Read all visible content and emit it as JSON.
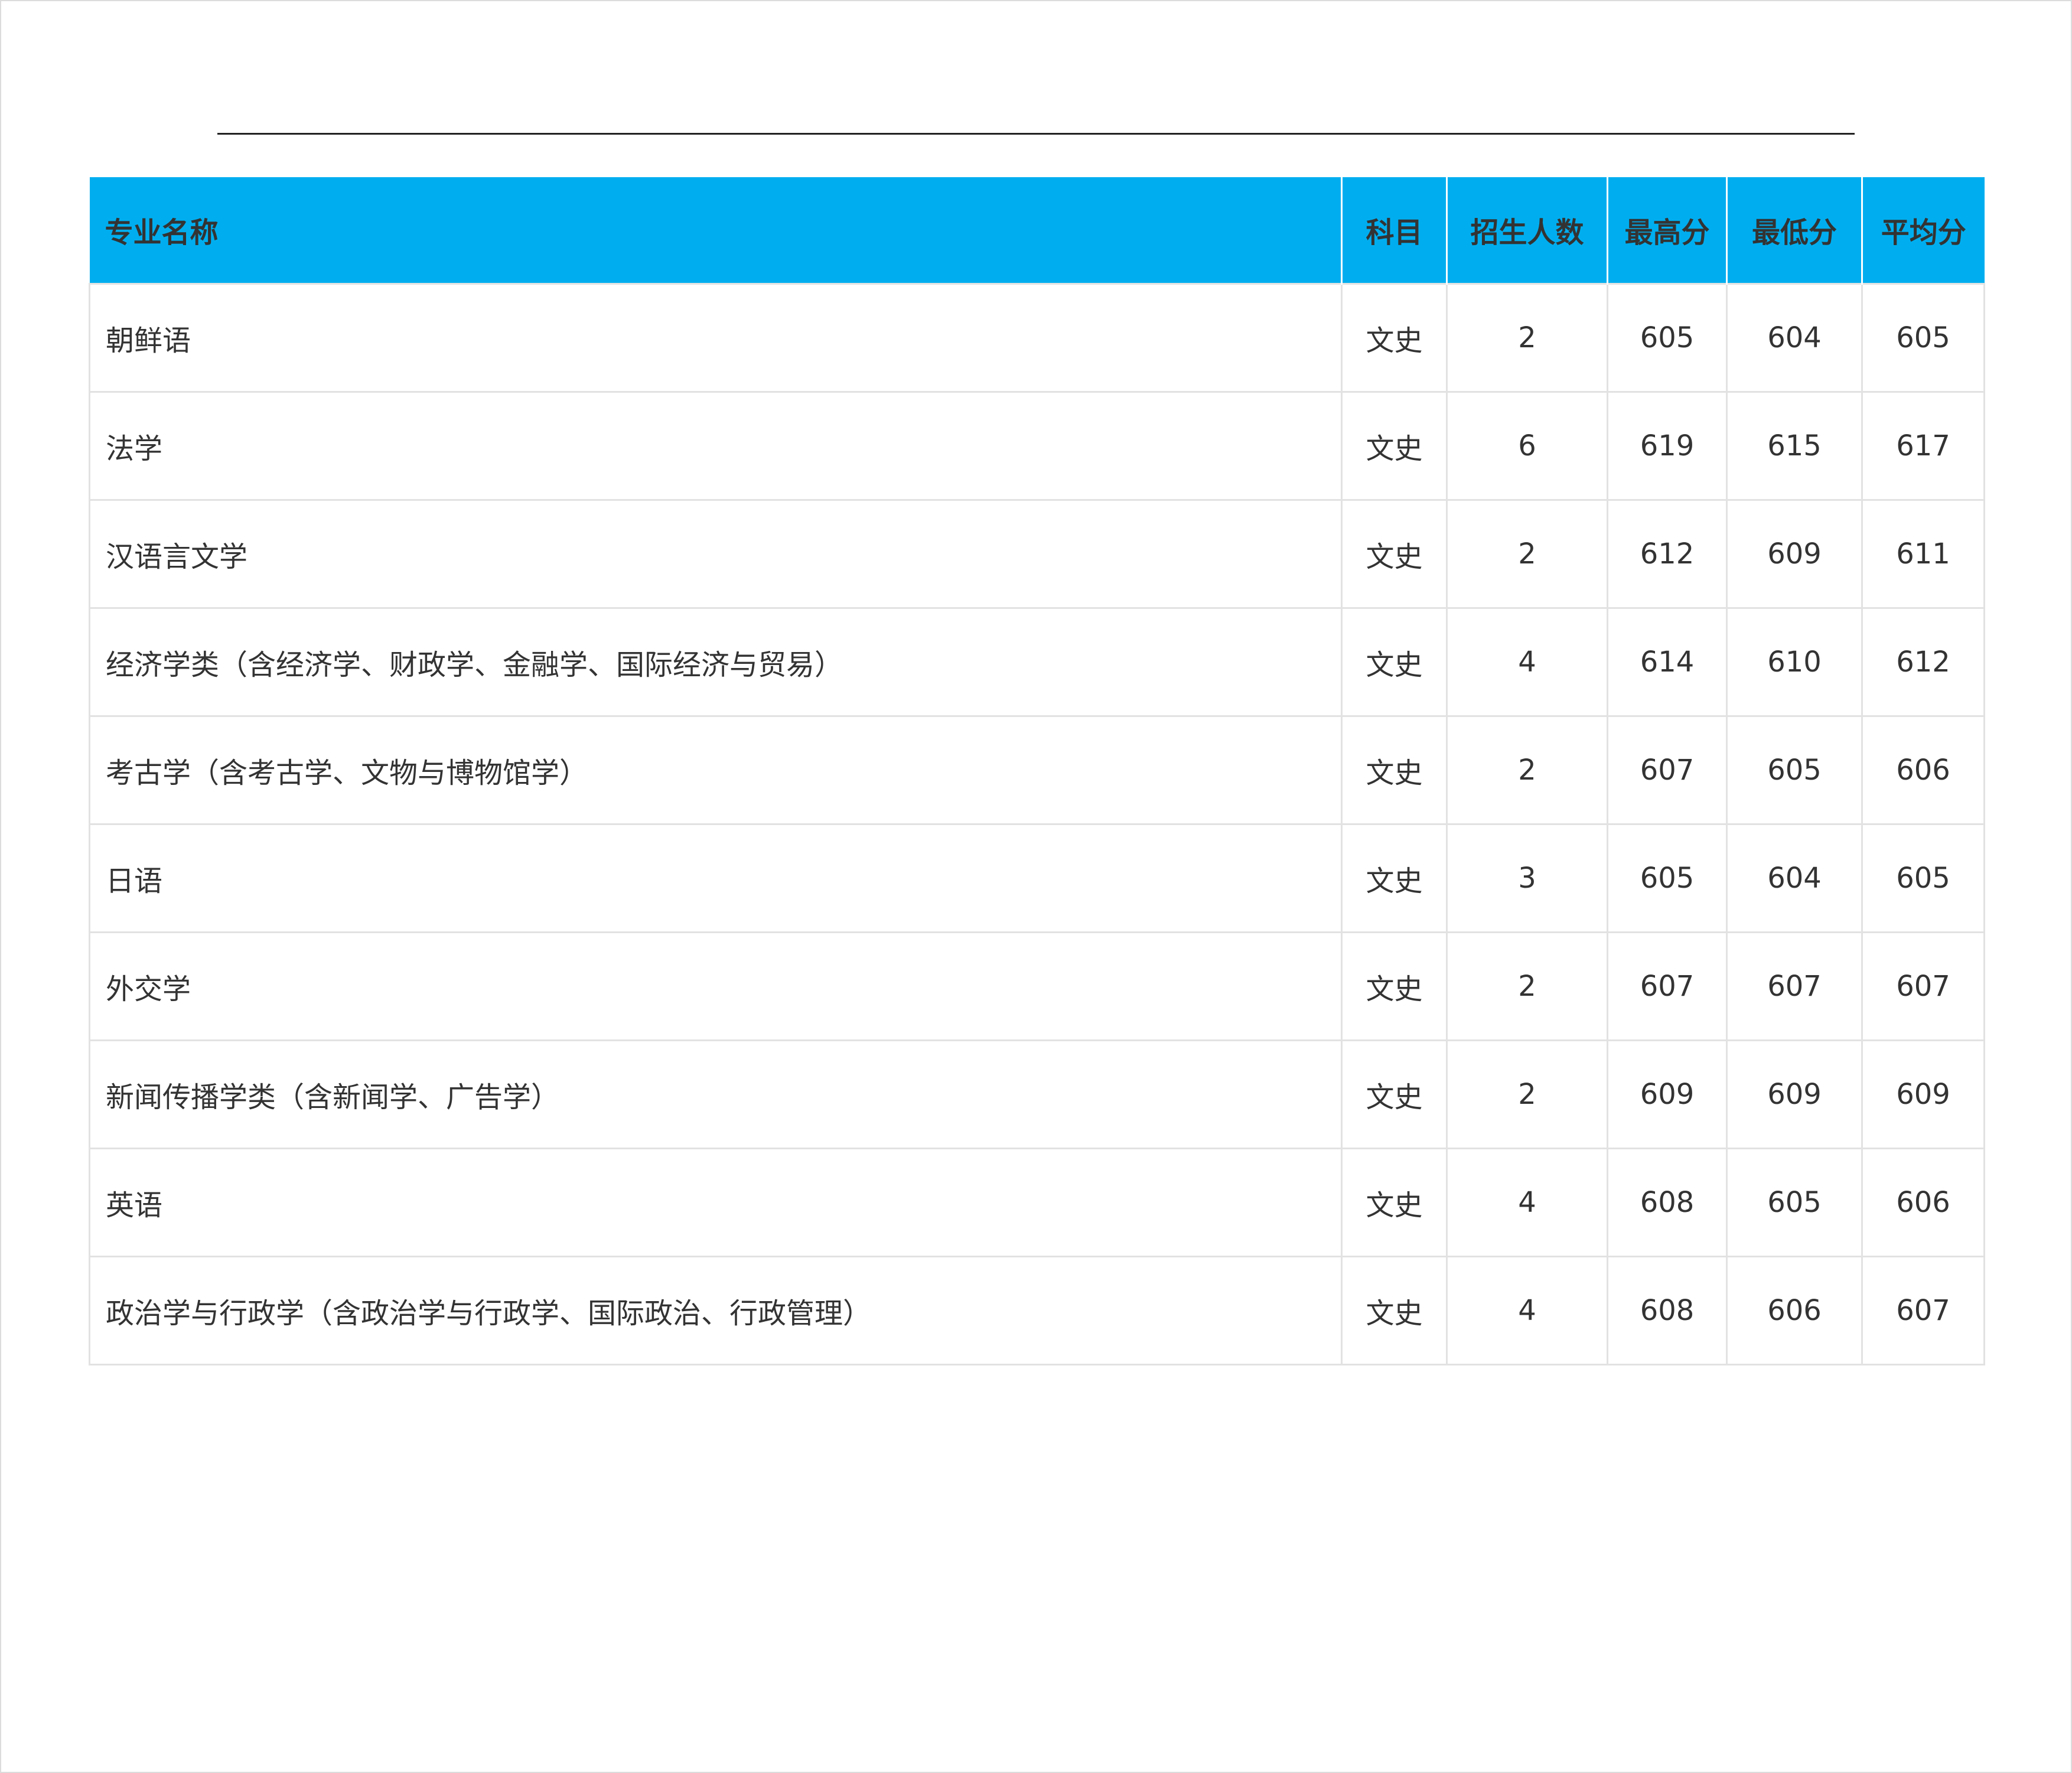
{
  "table": {
    "headers": [
      "专业名称",
      "科目",
      "招生人数",
      "最高分",
      "最低分",
      "平均分"
    ],
    "rows": [
      [
        "朝鲜语",
        "文史",
        "2",
        "605",
        "604",
        "605"
      ],
      [
        "法学",
        "文史",
        "6",
        "619",
        "615",
        "617"
      ],
      [
        "汉语言文学",
        "文史",
        "2",
        "612",
        "609",
        "611"
      ],
      [
        "经济学类（含经济学、财政学、金融学、国际经济与贸易）",
        "文史",
        "4",
        "614",
        "610",
        "612"
      ],
      [
        "考古学（含考古学、文物与博物馆学）",
        "文史",
        "2",
        "607",
        "605",
        "606"
      ],
      [
        "日语",
        "文史",
        "3",
        "605",
        "604",
        "605"
      ],
      [
        "外交学",
        "文史",
        "2",
        "607",
        "607",
        "607"
      ],
      [
        "新闻传播学类（含新闻学、广告学）",
        "文史",
        "2",
        "609",
        "609",
        "609"
      ],
      [
        "英语",
        "文史",
        "4",
        "608",
        "605",
        "606"
      ],
      [
        "政治学与行政学（含政治学与行政学、国际政治、行政管理）",
        "文史",
        "4",
        "608",
        "606",
        "607"
      ]
    ]
  },
  "colors": {
    "header_bg": "#00aeef",
    "text": "#333333",
    "border": "#e2e2e2"
  }
}
